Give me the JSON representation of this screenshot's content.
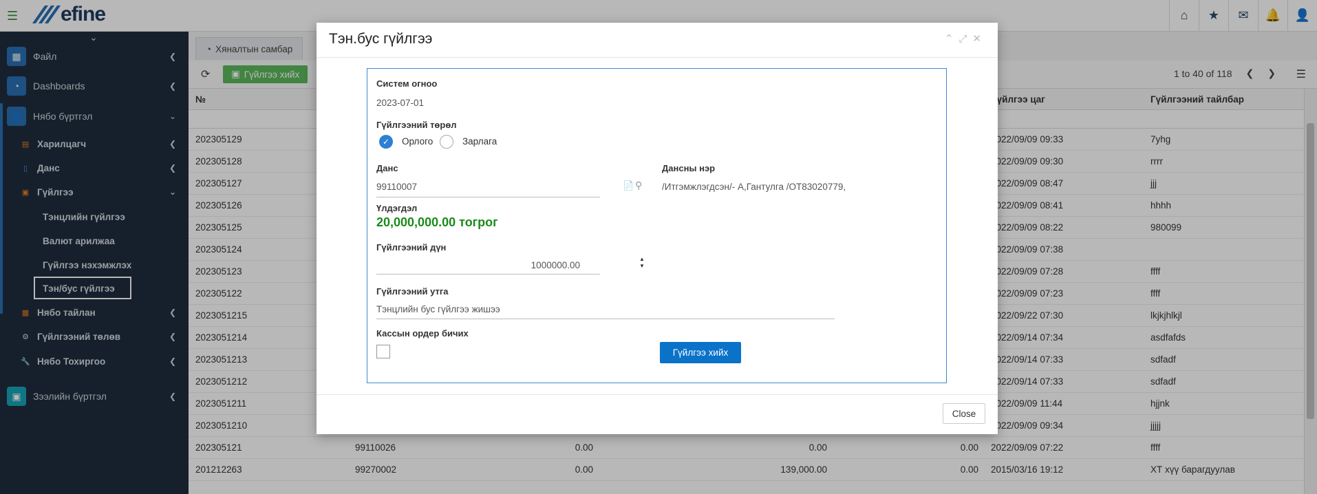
{
  "brand": {
    "logo_text": "efine"
  },
  "sidebar": {
    "file": "Файл",
    "dashboards": "Dashboards",
    "accounting": "Нябо бүртгэл",
    "customer": "Харилцагч",
    "account": "Данс",
    "transaction": "Гүйлгээ",
    "tx_cash": "Тэнцлийн гүйлгээ",
    "tx_fx": "Валют арилжаа",
    "tx_correct": "Гүйлгээ нэхэмжлэх",
    "tx_offbalance": "Тэн/бус гүйлгээ",
    "report": "Нябо тайлан",
    "tx_types": "Гүйлгээний төлөв",
    "settings": "Нябо Тохиргоо",
    "loans": "Зээлийн бүртгэл"
  },
  "main": {
    "tab_dashboard": "Хяналтын самбар",
    "make_tx_button": "Гүйлгээ хийх",
    "pager_text": "1 to 40 of 118",
    "columns": {
      "no": "№",
      "tx_time": "Гүйлгээ цаг",
      "tx_desc": "Гүйлгээний тайлбар"
    },
    "rows": [
      {
        "no": "202305129",
        "time": "2022/09/09 09:33",
        "desc": "7yhg"
      },
      {
        "no": "202305128",
        "time": "2022/09/09 09:30",
        "desc": "rrrr"
      },
      {
        "no": "202305127",
        "time": "2022/09/09 08:47",
        "desc": "jjj"
      },
      {
        "no": "202305126",
        "time": "2022/09/09 08:41",
        "desc": "hhhh"
      },
      {
        "no": "202305125",
        "time": "2022/09/09 08:22",
        "desc": "980099"
      },
      {
        "no": "202305124",
        "time": "2022/09/09 07:38",
        "desc": ""
      },
      {
        "no": "202305123",
        "time": "2022/09/09 07:28",
        "desc": "ffff"
      },
      {
        "no": "202305122",
        "time": "2022/09/09 07:23",
        "desc": "ffff"
      },
      {
        "no": "2023051215",
        "time": "2022/09/22 07:30",
        "desc": "lkjkjhlkjl"
      },
      {
        "no": "2023051214",
        "time": "2022/09/14 07:34",
        "desc": "asdfafds"
      },
      {
        "no": "2023051213",
        "time": "2022/09/14 07:33",
        "desc": "sdfadf"
      },
      {
        "no": "2023051212",
        "time": "2022/09/14 07:33",
        "desc": "sdfadf"
      },
      {
        "no": "2023051211",
        "time": "2022/09/09 11:44",
        "desc": "hjjnk"
      },
      {
        "no": "2023051210",
        "time": "2022/09/09 09:34",
        "desc": "jjjjj"
      },
      {
        "no": "202305121",
        "acct": "99110026",
        "a": "0.00",
        "b": "0.00",
        "c": "0.00",
        "time": "2022/09/09 07:22",
        "desc": "ffff"
      },
      {
        "no": "201212263",
        "acct": "99270002",
        "a": "0.00",
        "b": "139,000.00",
        "c": "0.00",
        "time": "2015/03/16 19:12",
        "desc": "ХТ хүү барагдуулав"
      }
    ]
  },
  "modal": {
    "title": "Тэн.бус гүйлгээ",
    "system_date_label": "Систем огноо",
    "system_date": "2023-07-01",
    "tx_type_label": "Гүйлгээний төрөл",
    "income": "Орлого",
    "expense": "Зарлага",
    "account_label": "Данс",
    "account_value": "99110007",
    "account_name_label": "Дансны нэр",
    "account_name": "/Итгэмжлэгдсэн/- А,Гантулга /ОТ83020779,",
    "balance_label": "Үлдэгдэл",
    "balance": "20,000,000.00 тогрог",
    "amount_label": "Гүйлгээний дүн",
    "amount": "1000000.00",
    "purpose_label": "Гүйлгээний утга",
    "purpose": "Тэнцлийн бус гүйлгээ жишээ",
    "cash_order_label": "Кассын ордер бичих",
    "submit": "Гүйлгээ хийх",
    "close": "Close"
  },
  "colors": {
    "accent": "#0a72c9",
    "green": "#5cb85c",
    "sidebar": "#1f2d3d",
    "balance": "#1a8a1a"
  }
}
